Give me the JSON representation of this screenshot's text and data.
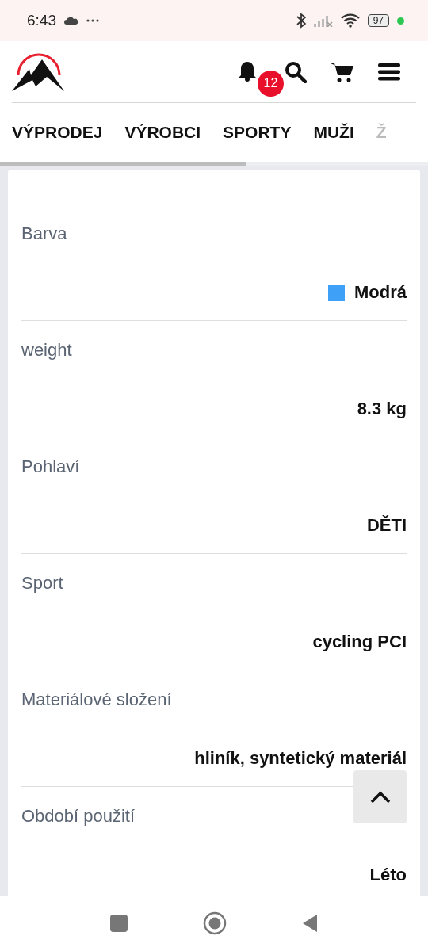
{
  "status_bar": {
    "time": "6:43",
    "battery": "97"
  },
  "header": {
    "notifications_badge": "12"
  },
  "nav_tabs": [
    {
      "label": "VÝPRODEJ"
    },
    {
      "label": "VÝROBCI"
    },
    {
      "label": "SPORTY"
    },
    {
      "label": "MUŽI"
    },
    {
      "label": "Ž"
    }
  ],
  "parameters": [
    {
      "label": "Barva",
      "value": "Modrá",
      "color": "#3ea0f7"
    },
    {
      "label": "weight",
      "value": "8.3 kg"
    },
    {
      "label": "Pohlaví",
      "value": "DĚTI"
    },
    {
      "label": "Sport",
      "value": "cycling PCI"
    },
    {
      "label": "Materiálové složení",
      "value": "hliník, syntetický materiál"
    },
    {
      "label": "Období použití",
      "value": "Léto"
    }
  ]
}
